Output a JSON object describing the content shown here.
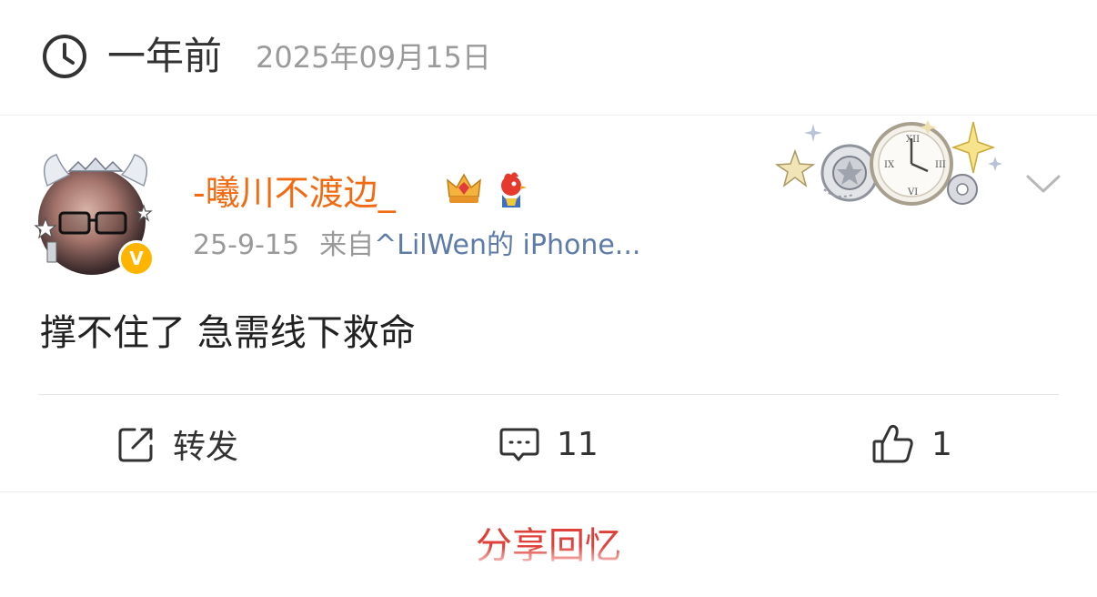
{
  "header": {
    "relative_time": "一年前",
    "date": "2025年09月15日",
    "icon": "clock-icon"
  },
  "post": {
    "username": "-曦川不渡边_",
    "verified_badge": "V",
    "badges": [
      "crown-badge-icon",
      "rooster-badge-icon"
    ],
    "time": "25-9-15",
    "source_prefix": "来自",
    "source": "^LilWen的 iPhone...",
    "content": "撑不住了 急需线下救命",
    "username_color": "#f26b13",
    "source_color": "#5d7aa8"
  },
  "actions": {
    "repost_label": "转发",
    "comment_count": "11",
    "like_count": "1"
  },
  "footer": {
    "share_label": "分享回忆",
    "share_color": "#e0403a"
  }
}
